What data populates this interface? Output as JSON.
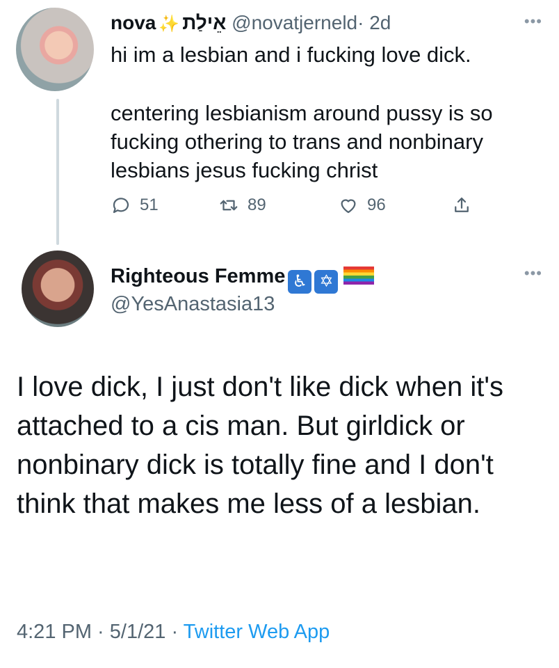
{
  "tweet1": {
    "display_name": "nova",
    "sparkle_icon": "✨",
    "hebrew_name": "אֵילַת",
    "handle": "@novatjerneld",
    "time": "· 2d",
    "text_line1": "hi im a lesbian and i fucking love dick.",
    "text_body": "centering lesbianism around pussy is so\nfucking othering to trans and nonbinary\nlesbians jesus fucking christ",
    "reply_count": "51",
    "retweet_count": "89",
    "like_count": "96",
    "more_icon": "•••"
  },
  "tweet2": {
    "display_name": "Righteous Femme",
    "badge_wheelchair": "♿",
    "badge_star": "✡",
    "handle": "@YesAnastasia13",
    "more_icon": "•••",
    "text": "I love dick, I just don't like dick when it's attached to a cis man. But girldick or nonbinary dick is totally fine and I don't think that makes me less of a lesbian.",
    "timestamp": "4:21 PM · 5/1/21 · ",
    "app": "Twitter Web App"
  },
  "colors": {
    "text": "#0f1419",
    "secondary": "#536471",
    "link": "#1d9bf0",
    "thread_line": "#cfd9de"
  }
}
